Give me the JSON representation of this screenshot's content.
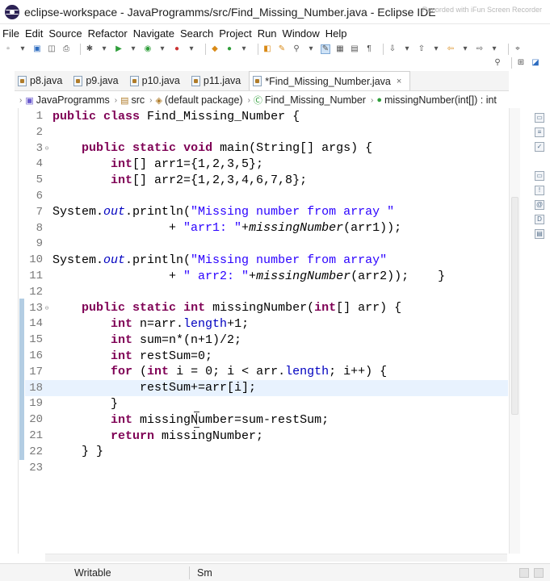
{
  "window": {
    "title": "eclipse-workspace - JavaProgramms/src/Find_Missing_Number.java - Eclipse IDE",
    "watermark": "Recorded with iFun Screen Recorder"
  },
  "menu": [
    "File",
    "Edit",
    "Source",
    "Refactor",
    "Navigate",
    "Search",
    "Project",
    "Run",
    "Window",
    "Help"
  ],
  "tabs": [
    {
      "label": "p8.java",
      "active": false
    },
    {
      "label": "p9.java",
      "active": false
    },
    {
      "label": "p10.java",
      "active": false
    },
    {
      "label": "p11.java",
      "active": false
    },
    {
      "label": "*Find_Missing_Number.java",
      "active": true,
      "close": "×"
    }
  ],
  "breadcrumb": [
    "JavaProgramms",
    "src",
    "(default package)",
    "Find_Missing_Number",
    "missingNumber(int[]) : int"
  ],
  "code": {
    "lines": [
      {
        "n": "1",
        "segments": [
          [
            "kw",
            "public"
          ],
          [
            "t",
            " "
          ],
          [
            "kw",
            "class"
          ],
          [
            "t",
            " Find_Missing_Number {"
          ]
        ]
      },
      {
        "n": "2",
        "segments": []
      },
      {
        "n": "3",
        "fold": "⊖",
        "segments": [
          [
            "t",
            "    "
          ],
          [
            "kw",
            "public"
          ],
          [
            "t",
            " "
          ],
          [
            "kw",
            "static"
          ],
          [
            "t",
            " "
          ],
          [
            "kw",
            "void"
          ],
          [
            "t",
            " main(String[] args) {"
          ]
        ]
      },
      {
        "n": "4",
        "segments": [
          [
            "t",
            "        "
          ],
          [
            "kw",
            "int"
          ],
          [
            "t",
            "[] arr1={1,2,3,5};"
          ]
        ]
      },
      {
        "n": "5",
        "segments": [
          [
            "t",
            "        "
          ],
          [
            "kw",
            "int"
          ],
          [
            "t",
            "[] arr2={1,2,3,4,6,7,8};"
          ]
        ]
      },
      {
        "n": "6",
        "segments": []
      },
      {
        "n": "7",
        "segments": [
          [
            "t",
            "System."
          ],
          [
            "fi",
            "out"
          ],
          [
            "t",
            ".println("
          ],
          [
            "str",
            "\"Missing number from array \""
          ]
        ]
      },
      {
        "n": "8",
        "segments": [
          [
            "t",
            "                + "
          ],
          [
            "str",
            "\"arr1: \""
          ],
          [
            "t",
            "+"
          ],
          [
            "i",
            "missingNumber"
          ],
          [
            "t",
            "(arr1));"
          ]
        ]
      },
      {
        "n": "9",
        "segments": []
      },
      {
        "n": "10",
        "segments": [
          [
            "t",
            "System."
          ],
          [
            "fi",
            "out"
          ],
          [
            "t",
            ".println("
          ],
          [
            "str",
            "\"Missing number from array\""
          ]
        ]
      },
      {
        "n": "11",
        "segments": [
          [
            "t",
            "                + "
          ],
          [
            "str",
            "\" arr2: \""
          ],
          [
            "t",
            "+"
          ],
          [
            "i",
            "missingNumber"
          ],
          [
            "t",
            "(arr2));    }"
          ]
        ]
      },
      {
        "n": "12",
        "segments": []
      },
      {
        "n": "13",
        "fold": "⊖",
        "segments": [
          [
            "t",
            "    "
          ],
          [
            "kw",
            "public"
          ],
          [
            "t",
            " "
          ],
          [
            "kw",
            "static"
          ],
          [
            "t",
            " "
          ],
          [
            "kw",
            "int"
          ],
          [
            "t",
            " missingNumber("
          ],
          [
            "kw",
            "int"
          ],
          [
            "t",
            "[] arr) {"
          ]
        ]
      },
      {
        "n": "14",
        "segments": [
          [
            "t",
            "        "
          ],
          [
            "kw",
            "int"
          ],
          [
            "t",
            " n=arr."
          ],
          [
            "f",
            "length"
          ],
          [
            "t",
            "+1;"
          ]
        ]
      },
      {
        "n": "15",
        "segments": [
          [
            "t",
            "        "
          ],
          [
            "kw",
            "int"
          ],
          [
            "t",
            " sum=n*(n+1)/2;"
          ]
        ]
      },
      {
        "n": "16",
        "segments": [
          [
            "t",
            "        "
          ],
          [
            "kw",
            "int"
          ],
          [
            "t",
            " restSum=0;"
          ]
        ]
      },
      {
        "n": "17",
        "segments": [
          [
            "t",
            "        "
          ],
          [
            "kw",
            "for"
          ],
          [
            "t",
            " ("
          ],
          [
            "kw",
            "int"
          ],
          [
            "t",
            " i = 0; i < arr."
          ],
          [
            "f",
            "length"
          ],
          [
            "t",
            "; i++) {"
          ]
        ]
      },
      {
        "n": "18",
        "current": true,
        "segments": [
          [
            "t",
            "            restSum+=arr[i];"
          ]
        ]
      },
      {
        "n": "19",
        "segments": [
          [
            "t",
            "        }"
          ]
        ]
      },
      {
        "n": "20",
        "segments": [
          [
            "t",
            "        "
          ],
          [
            "kw",
            "int"
          ],
          [
            "t",
            " missingNumber=sum-restSum;"
          ]
        ]
      },
      {
        "n": "21",
        "segments": [
          [
            "t",
            "        "
          ],
          [
            "kw",
            "return"
          ],
          [
            "t",
            " missingNumber;"
          ]
        ]
      },
      {
        "n": "22",
        "segments": [
          [
            "t",
            "    } }"
          ]
        ]
      },
      {
        "n": "23",
        "segments": []
      }
    ]
  },
  "status": {
    "writable": "Writable",
    "insert_mode": "Sm"
  },
  "colors": {
    "keyword": "#7f0055",
    "string": "#2a00ff",
    "field": "#0000c0",
    "current_line": "#e8f2fe"
  }
}
